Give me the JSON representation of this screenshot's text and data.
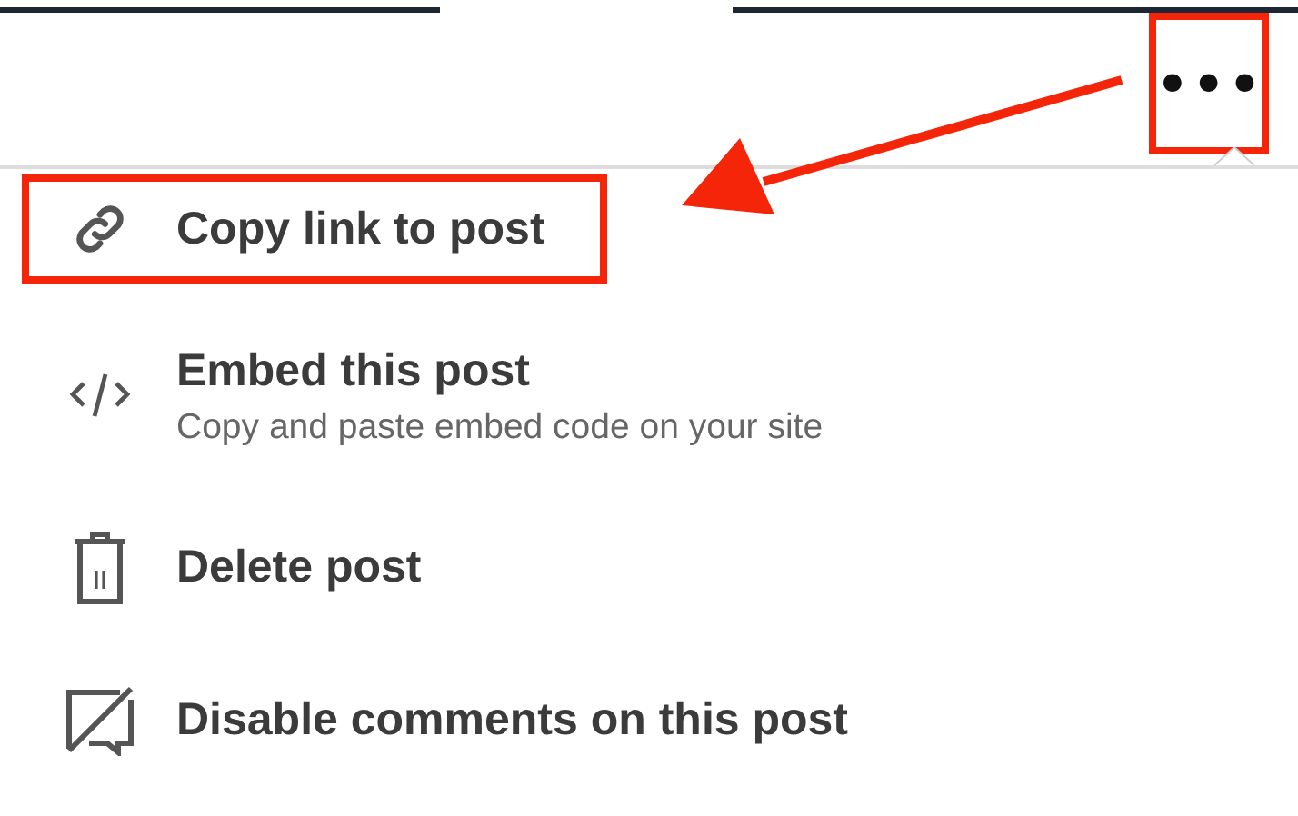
{
  "more_button": {
    "label": "•••",
    "highlighted": true
  },
  "menu": {
    "items": [
      {
        "kind": "link",
        "title": "Copy link to post",
        "highlighted": true
      },
      {
        "kind": "code",
        "title": "Embed this post",
        "subtitle": "Copy and paste embed code on your site",
        "highlighted": false
      },
      {
        "kind": "trash",
        "title": "Delete post",
        "highlighted": false
      },
      {
        "kind": "comment-off",
        "title": "Disable comments on this post",
        "highlighted": false
      }
    ]
  }
}
